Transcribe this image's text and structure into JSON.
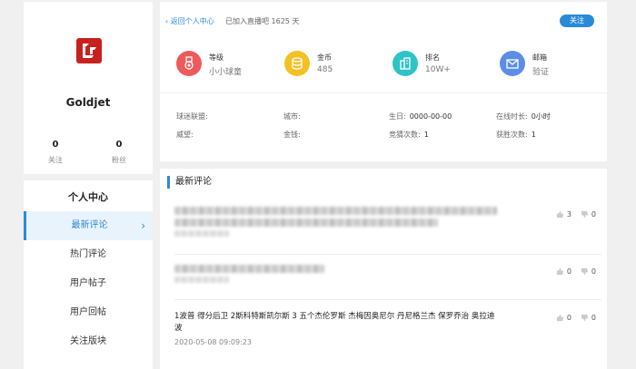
{
  "profile": {
    "username": "Goldjet",
    "follow_count": "0",
    "follow_label": "关注",
    "fans_count": "0",
    "fans_label": "粉丝"
  },
  "nav": {
    "title": "个人中心",
    "items": [
      {
        "label": "最新评论",
        "active": true
      },
      {
        "label": "热门评论"
      },
      {
        "label": "用户帖子"
      },
      {
        "label": "用户回帖"
      },
      {
        "label": "关注版块"
      }
    ]
  },
  "header": {
    "back_label": "返回个人中心",
    "joined_text": "已加入直播吧 1625 天",
    "follow_button": "关注",
    "badges": [
      {
        "title": "等级",
        "value": "小小球童",
        "icon": "medal-icon",
        "color": "#ee5a5a"
      },
      {
        "title": "金币",
        "value": "485",
        "icon": "coins-icon",
        "color": "#f5c024"
      },
      {
        "title": "排名",
        "value": "10W+",
        "icon": "building-icon",
        "color": "#2ec3c7"
      },
      {
        "title": "邮箱",
        "value": "验证",
        "icon": "mail-icon",
        "color": "#5b8ee6"
      }
    ],
    "info": {
      "fan_league": {
        "label": "球迷联盟:",
        "value": ""
      },
      "city": {
        "label": "城市:",
        "value": ""
      },
      "birthday": {
        "label": "生日:",
        "value": "0000-00-00"
      },
      "online_time": {
        "label": "在线时长:",
        "value": "0小时"
      },
      "prestige": {
        "label": "威望:",
        "value": ""
      },
      "money": {
        "label": "金钱:",
        "value": ""
      },
      "guess_count": {
        "label": "竞猜次数:",
        "value": "1"
      },
      "win_count": {
        "label": "获胜次数:",
        "value": "1"
      }
    }
  },
  "comments": {
    "title": "最新评论",
    "items": [
      {
        "text": "",
        "time": "",
        "likes": "3",
        "dislikes": "0",
        "blurred": true
      },
      {
        "text": "",
        "time": "",
        "likes": "0",
        "dislikes": "0",
        "blurred": true
      },
      {
        "text": "1波普 得分后卫 2斯科特斯凯尔斯 3 五个杰伦罗斯 杰梅因奥尼尔 丹尼格兰杰 保罗乔治 奥拉迪波",
        "time": "2020-05-08 09:09:23",
        "likes": "0",
        "dislikes": "0",
        "blurred": false
      }
    ]
  }
}
